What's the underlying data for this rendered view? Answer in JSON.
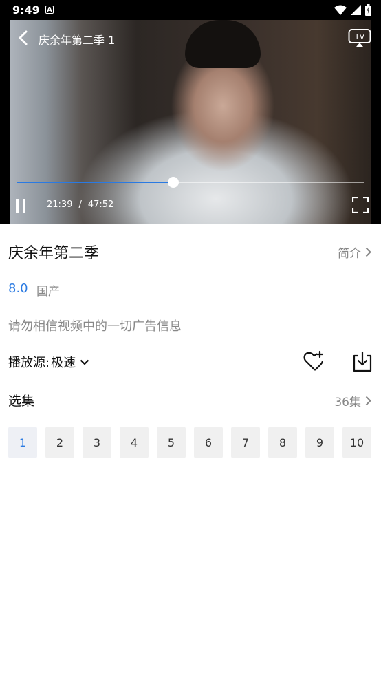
{
  "status_bar": {
    "time": "9:49",
    "notif_letter": "A"
  },
  "player": {
    "title": "庆余年第二季 1",
    "tv_label": "TV",
    "current_time": "21:39",
    "separator": "/",
    "duration": "47:52",
    "progress_fraction": 0.452
  },
  "info": {
    "title": "庆余年第二季",
    "intro_label": "简介",
    "rating": "8.0",
    "region": "国产",
    "notice": "请勿相信视频中的一切广告信息"
  },
  "source": {
    "label": "播放源:",
    "value": "极速"
  },
  "episodes": {
    "title": "选集",
    "count_label": "36集",
    "items": [
      "1",
      "2",
      "3",
      "4",
      "5",
      "6",
      "7",
      "8",
      "9",
      "10"
    ],
    "selected_index": 0
  },
  "colors": {
    "accent": "#2a7ae2",
    "muted": "#888888"
  }
}
